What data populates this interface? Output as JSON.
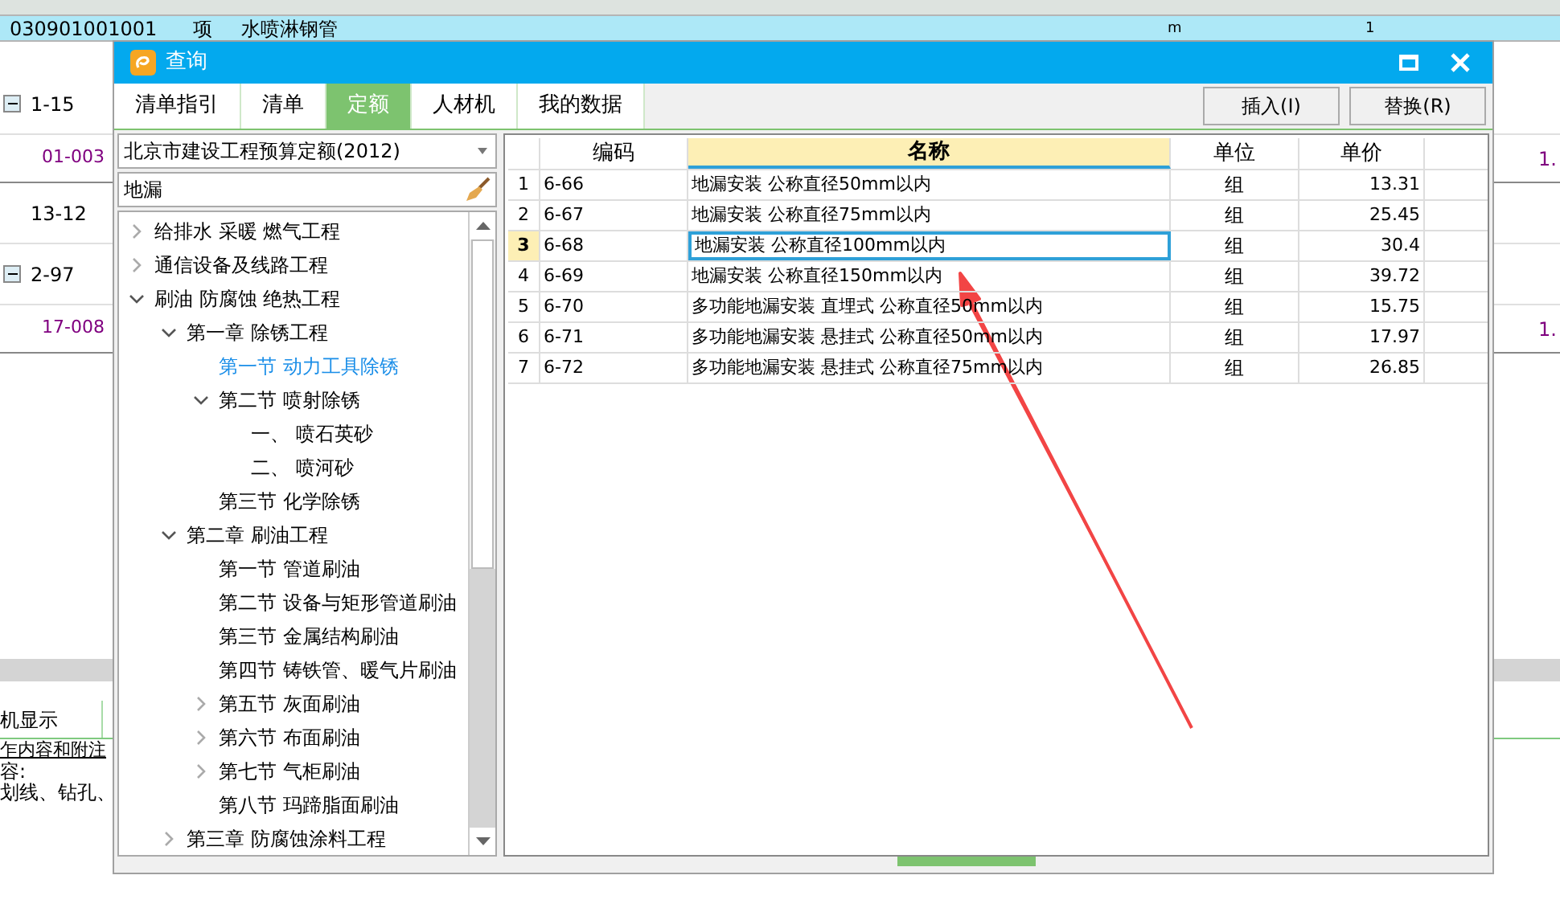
{
  "background": {
    "row": {
      "code": "030901001001",
      "type": "项",
      "name": "水喷淋钢管",
      "unit": "m",
      "qty": "1"
    },
    "tree": [
      {
        "label": "1-15",
        "expanded": true,
        "children": [
          {
            "label": "01-003",
            "value": "1."
          }
        ]
      },
      {
        "label": "13-12"
      },
      {
        "label": "2-97",
        "expanded": true,
        "children": [
          {
            "label": "17-008",
            "value": "1."
          }
        ]
      }
    ],
    "bottom_tabs": [
      "机显示"
    ],
    "bottom_link": "乍内容和附注",
    "bottom_lines": [
      "容:",
      "划线、钻孔、"
    ]
  },
  "dialog": {
    "title": "查询",
    "tabs": [
      {
        "label": "清单指引",
        "selected": false
      },
      {
        "label": "清单",
        "selected": false
      },
      {
        "label": "定额",
        "selected": true
      },
      {
        "label": "人材机",
        "selected": false
      },
      {
        "label": "我的数据",
        "selected": false
      }
    ],
    "buttons": [
      "插入(I)",
      "替换(R)"
    ],
    "library": "北京市建设工程预算定额(2012)",
    "search": {
      "value": "地漏"
    },
    "tree": [
      {
        "label": "给排水 采暖 燃气工程",
        "expanded": false,
        "selected": false
      },
      {
        "label": "通信设备及线路工程",
        "expanded": false,
        "selected": false
      },
      {
        "label": "刷油 防腐蚀 绝热工程",
        "expanded": true,
        "selected": false,
        "children": [
          {
            "label": "第一章 除锈工程",
            "expanded": true,
            "selected": false,
            "children": [
              {
                "label": "第一节 动力工具除锈",
                "selected": true
              },
              {
                "label": "第二节 喷射除锈",
                "expanded": true,
                "selected": false,
                "children": [
                  {
                    "label": "一、 喷石英砂",
                    "selected": false
                  },
                  {
                    "label": "二、 喷河砂",
                    "selected": false
                  }
                ]
              },
              {
                "label": "第三节 化学除锈",
                "selected": false
              }
            ]
          },
          {
            "label": "第二章 刷油工程",
            "expanded": true,
            "selected": false,
            "children": [
              {
                "label": "第一节 管道刷油",
                "selected": false
              },
              {
                "label": "第二节 设备与矩形管道刷油",
                "selected": false
              },
              {
                "label": "第三节 金属结构刷油",
                "selected": false
              },
              {
                "label": "第四节 铸铁管、暖气片刷油",
                "selected": false
              },
              {
                "label": "第五节 灰面刷油",
                "expanded": false,
                "selected": false
              },
              {
                "label": "第六节 布面刷油",
                "expanded": false,
                "selected": false
              },
              {
                "label": "第七节 气柜刷油",
                "expanded": false,
                "selected": false
              },
              {
                "label": "第八节 玛蹄脂面刷油",
                "selected": false
              }
            ]
          },
          {
            "label": "第三章 防腐蚀涂料工程",
            "expanded": false,
            "selected": false
          }
        ]
      }
    ],
    "table": {
      "columns": [
        {
          "label": "编码",
          "selected": false
        },
        {
          "label": "名称",
          "selected": true
        },
        {
          "label": "单位",
          "selected": false
        },
        {
          "label": "单价",
          "selected": false
        }
      ],
      "rows": [
        {
          "index": "1",
          "code": "6-66",
          "name": "地漏安装 公称直径50mm以内",
          "unit": "组",
          "price": "13.31",
          "selected": false
        },
        {
          "index": "2",
          "code": "6-67",
          "name": "地漏安装 公称直径75mm以内",
          "unit": "组",
          "price": "25.45",
          "selected": false
        },
        {
          "index": "3",
          "code": "6-68",
          "name": "地漏安装 公称直径100mm以内",
          "unit": "组",
          "price": "30.4",
          "selected": true
        },
        {
          "index": "4",
          "code": "6-69",
          "name": "地漏安装 公称直径150mm以内",
          "unit": "组",
          "price": "39.72",
          "selected": false
        },
        {
          "index": "5",
          "code": "6-70",
          "name": "多功能地漏安装 直埋式 公称直径50mm以内",
          "unit": "组",
          "price": "15.75",
          "selected": false
        },
        {
          "index": "6",
          "code": "6-71",
          "name": "多功能地漏安装 悬挂式 公称直径50mm以内",
          "unit": "组",
          "price": "17.97",
          "selected": false
        },
        {
          "index": "7",
          "code": "6-72",
          "name": "多功能地漏安装 悬挂式 公称直径75mm以内",
          "unit": "组",
          "price": "26.85",
          "selected": false
        }
      ]
    }
  }
}
